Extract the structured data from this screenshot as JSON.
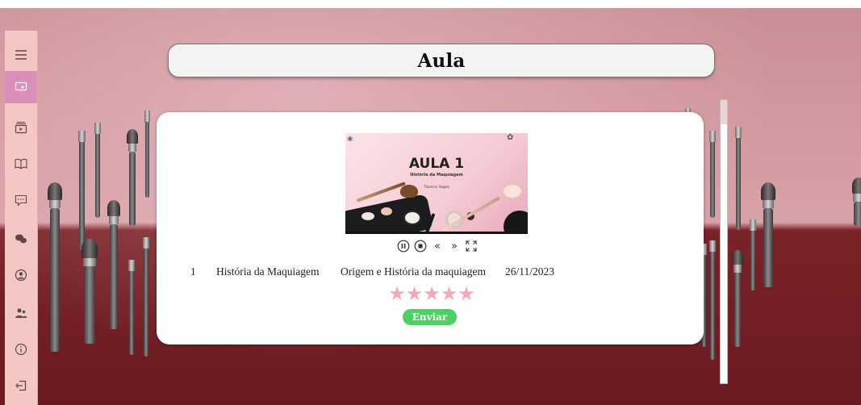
{
  "sidebar": {
    "items": [
      {
        "name": "menu",
        "icon": "menu-icon"
      },
      {
        "name": "lesson",
        "icon": "screen-user-icon",
        "active": true
      },
      {
        "name": "videos",
        "icon": "play-list-icon"
      },
      {
        "name": "book",
        "icon": "book-icon"
      },
      {
        "name": "chat",
        "icon": "chat-icon"
      },
      {
        "name": "community",
        "icon": "group-chat-icon"
      },
      {
        "name": "profile",
        "icon": "user-circle-icon"
      },
      {
        "name": "users",
        "icon": "users-icon"
      },
      {
        "name": "info",
        "icon": "info-icon"
      },
      {
        "name": "logout",
        "icon": "logout-icon"
      }
    ]
  },
  "header": {
    "title": "Aula"
  },
  "video": {
    "title": "AULA 1",
    "subtitle": "História da Maquiagem",
    "author": "Thamiris Vogolo"
  },
  "controls": {
    "pause": "pause-icon",
    "stop": "stop-icon",
    "rewind": "«",
    "forward": "»",
    "fullscreen": "fullscreen-icon"
  },
  "lesson": {
    "number": "1",
    "name": "História da Maquiagem",
    "description": "Origem e História da maquiagem",
    "date": "26/11/2023"
  },
  "rating": {
    "stars": "★★★★★",
    "max": 5,
    "value": 0
  },
  "actions": {
    "submit_label": "Enviar"
  },
  "colors": {
    "accent": "#d98fb7",
    "sidebar_bg": "#f4c6c4",
    "star": "#f5a9b8",
    "button": "#4bd163"
  }
}
